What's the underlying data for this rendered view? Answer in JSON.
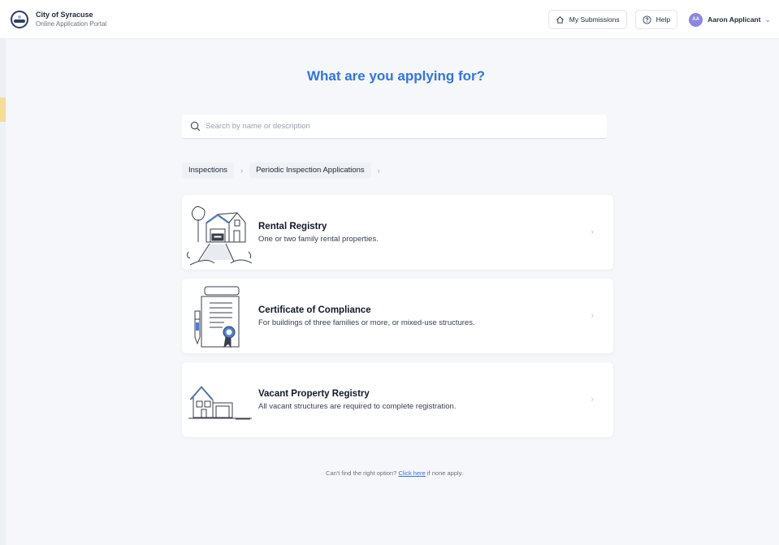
{
  "header": {
    "brand_title": "City of Syracuse",
    "brand_subtitle": "Online Application Portal",
    "my_submissions_label": "My Submissions",
    "help_label": "Help",
    "user_initials": "AA",
    "user_name": "Aaron Applicant"
  },
  "main": {
    "heading": "What are you applying for?",
    "search_placeholder": "Search by name or description",
    "breadcrumbs": [
      "Inspections",
      "Periodic Inspection Applications"
    ],
    "options": [
      {
        "title": "Rental Registry",
        "description": "One or two family rental properties.",
        "icon": "house-rental-icon"
      },
      {
        "title": "Certificate of Compliance",
        "description": "For buildings of three families or more, or mixed-use structures.",
        "icon": "certificate-document-icon"
      },
      {
        "title": "Vacant Property Registry",
        "description": "All vacant structures are required to complete registration.",
        "icon": "vacant-house-icon"
      }
    ],
    "footer_text": "Can't find the right option?",
    "footer_link": "Click here",
    "footer_suffix": "if none apply."
  },
  "colors": {
    "accent": "#2f74e8",
    "avatar": "#8b86e0",
    "brand_navy": "#2d3e66"
  }
}
